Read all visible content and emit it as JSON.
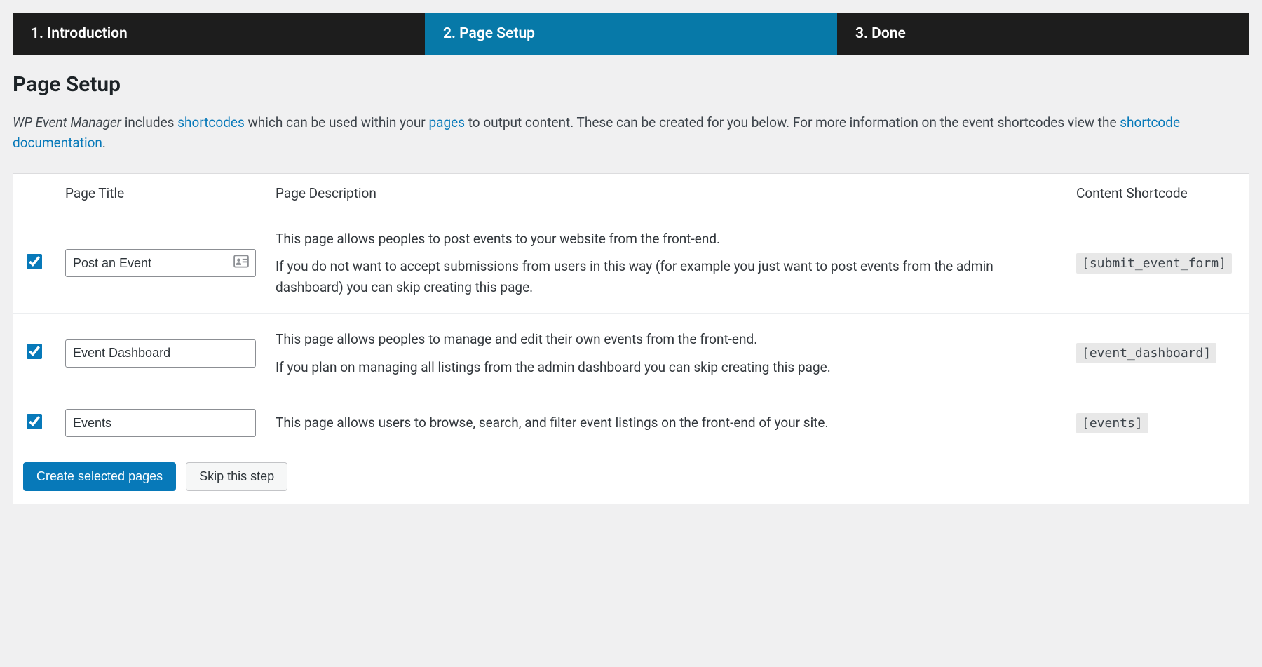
{
  "stepper": {
    "steps": [
      {
        "label": "1. Introduction",
        "active": false
      },
      {
        "label": "2. Page Setup",
        "active": true
      },
      {
        "label": "3. Done",
        "active": false
      }
    ]
  },
  "page_title": "Page Setup",
  "intro": {
    "product": "WP Event Manager",
    "text_before_link1": " includes ",
    "link1": "shortcodes",
    "text_between_1_2": " which can be used within your ",
    "link2": "pages",
    "text_between_2_3": " to output content. These can be created for you below. For more information on the event shortcodes view the ",
    "link3": "shortcode documentation",
    "text_after": "."
  },
  "table": {
    "headers": {
      "title": "Page Title",
      "description": "Page Description",
      "shortcode": "Content Shortcode"
    },
    "rows": [
      {
        "checked": true,
        "title": "Post an Event",
        "has_badge": true,
        "desc1": "This page allows peoples to post events to your website from the front-end.",
        "desc2": "If you do not want to accept submissions from users in this way (for example you just want to post events from the admin dashboard) you can skip creating this page.",
        "shortcode": "[submit_event_form]"
      },
      {
        "checked": true,
        "title": "Event Dashboard",
        "has_badge": false,
        "desc1": "This page allows peoples to manage and edit their own events from the front-end.",
        "desc2": "If you plan on managing all listings from the admin dashboard you can skip creating this page.",
        "shortcode": "[event_dashboard]"
      },
      {
        "checked": true,
        "title": "Events",
        "has_badge": false,
        "desc1": "This page allows users to browse, search, and filter event listings on the front-end of your site.",
        "desc2": "",
        "shortcode": "[events]"
      }
    ]
  },
  "actions": {
    "primary": "Create selected pages",
    "secondary": "Skip this step"
  }
}
